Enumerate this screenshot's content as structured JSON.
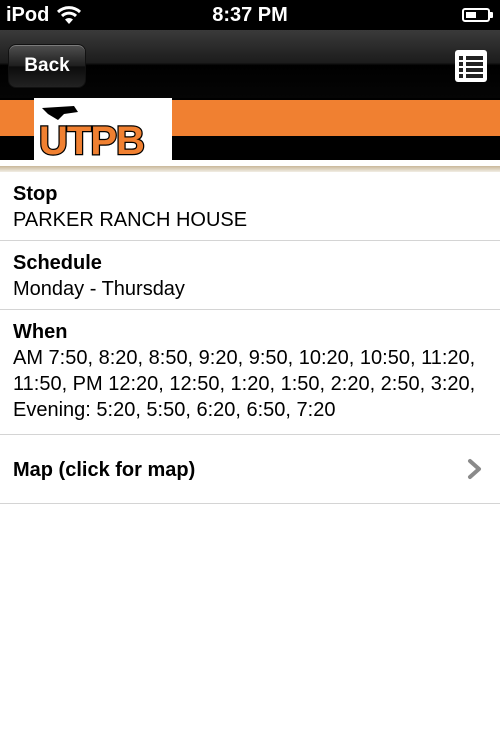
{
  "status_bar": {
    "carrier": "iPod",
    "time": "8:37 PM"
  },
  "nav_bar": {
    "back_label": "Back",
    "menu_icon": "list-menu-icon"
  },
  "banner": {
    "logo_text": "UTPB",
    "colors": {
      "orange": "#f08031",
      "black": "#000000"
    }
  },
  "details": {
    "stop": {
      "label": "Stop",
      "value": "PARKER RANCH HOUSE"
    },
    "schedule": {
      "label": "Schedule",
      "value": "Monday - Thursday"
    },
    "when": {
      "label": "When",
      "value": "AM 7:50, 8:20, 8:50, 9:20, 9:50, 10:20, 10:50, 11:20, 11:50, PM 12:20, 12:50, 1:20, 1:50, 2:20, 2:50, 3:20, Evening: 5:20, 5:50, 6:20, 6:50, 7:20"
    },
    "map": {
      "label": "Map (click for map)",
      "icon": "chevron-right-icon"
    }
  }
}
